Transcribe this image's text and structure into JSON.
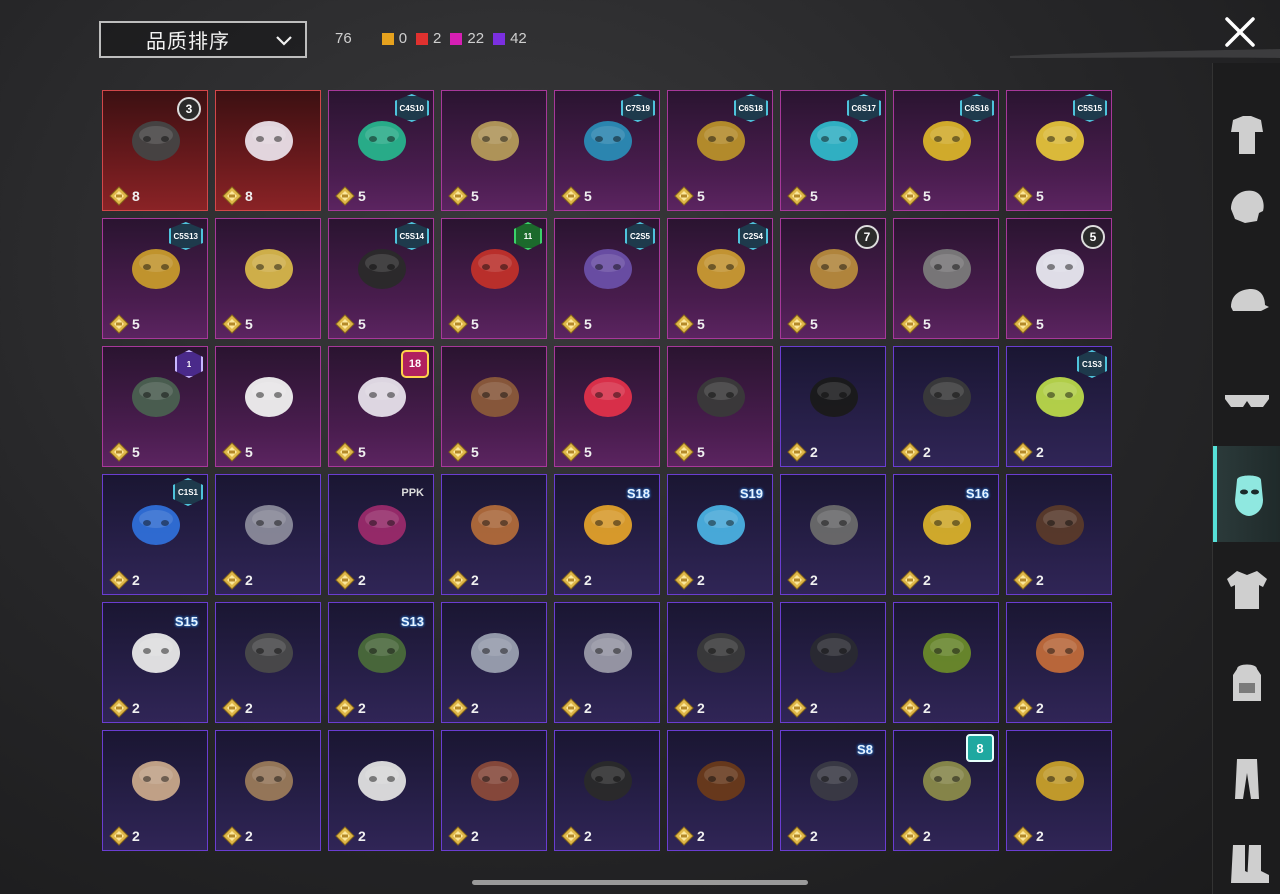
{
  "header": {
    "sort_label": "品质排序",
    "total_count": "76",
    "counts": [
      {
        "color": "#e6a21e",
        "value": "0"
      },
      {
        "color": "#e0312f",
        "value": "2"
      },
      {
        "color": "#d61fb4",
        "value": "22"
      },
      {
        "color": "#7b2fe0",
        "value": "42"
      }
    ]
  },
  "sidebar": {
    "active_index": 4,
    "categories": [
      {
        "icon": "outfit-icon"
      },
      {
        "icon": "face-icon"
      },
      {
        "icon": "cap-icon"
      },
      {
        "icon": "glasses-icon"
      },
      {
        "icon": "mask-icon"
      },
      {
        "icon": "jacket-icon"
      },
      {
        "icon": "backpack-icon"
      },
      {
        "icon": "pants-icon"
      },
      {
        "icon": "boots-icon"
      }
    ]
  },
  "items": [
    {
      "q": "red",
      "price": "8",
      "tag": "3",
      "tag_style": "num",
      "icon": "wolf-mask-icon",
      "col": "#444"
    },
    {
      "q": "red",
      "price": "8",
      "tag": "",
      "tag_style": "",
      "icon": "cloth-mask-icon",
      "col": "#e9dfe8"
    },
    {
      "q": "pink",
      "price": "5",
      "tag": "C4S10",
      "tag_style": "",
      "icon": "green-mask-icon",
      "col": "#27b38c"
    },
    {
      "q": "pink",
      "price": "5",
      "tag": "",
      "tag_style": "",
      "icon": "duck-mask-icon",
      "col": "#b49a5a"
    },
    {
      "q": "pink",
      "price": "5",
      "tag": "C7S19",
      "tag_style": "",
      "icon": "tech-mask-icon",
      "col": "#2a8bb5"
    },
    {
      "q": "pink",
      "price": "5",
      "tag": "C6S18",
      "tag_style": "",
      "icon": "gold-mandible-icon",
      "col": "#b8902a"
    },
    {
      "q": "pink",
      "price": "5",
      "tag": "C6S17",
      "tag_style": "",
      "icon": "graffiti-mask-icon",
      "col": "#2fb7c9"
    },
    {
      "q": "pink",
      "price": "5",
      "tag": "C6S16",
      "tag_style": "",
      "icon": "gas-mask-icon",
      "col": "#d8b22a"
    },
    {
      "q": "pink",
      "price": "5",
      "tag": "C5S15",
      "tag_style": "",
      "icon": "respirator-icon",
      "col": "#e3c23a"
    },
    {
      "q": "pink",
      "price": "5",
      "tag": "C5S13",
      "tag_style": "",
      "icon": "black-gold-mask-icon",
      "col": "#c79a2c"
    },
    {
      "q": "pink",
      "price": "5",
      "tag": "",
      "tag_style": "",
      "icon": "gold-helm-mask-icon",
      "col": "#d6b64a"
    },
    {
      "q": "pink",
      "price": "5",
      "tag": "C5S14",
      "tag_style": "",
      "icon": "black-mask-icon",
      "col": "#2a2a2a"
    },
    {
      "q": "pink",
      "price": "5",
      "tag": "11",
      "tag_style": "green",
      "icon": "oni-mask-icon",
      "col": "#c0302a"
    },
    {
      "q": "pink",
      "price": "5",
      "tag": "C2S5",
      "tag_style": "",
      "icon": "purple-mask-icon",
      "col": "#6a4fa8"
    },
    {
      "q": "pink",
      "price": "5",
      "tag": "C2S4",
      "tag_style": "",
      "icon": "gold-tech-mask-icon",
      "col": "#c99a32"
    },
    {
      "q": "pink",
      "price": "5",
      "tag": "7",
      "tag_style": "num",
      "icon": "gold-purple-mask-icon",
      "col": "#b68a3c"
    },
    {
      "q": "pink",
      "price": "5",
      "tag": "",
      "tag_style": "",
      "icon": "steel-mask-icon",
      "col": "#7a7a7a"
    },
    {
      "q": "pink",
      "price": "5",
      "tag": "5",
      "tag_style": "num",
      "icon": "clown-mask-icon",
      "col": "#e8e8f0"
    },
    {
      "q": "pink",
      "price": "5",
      "tag": "1",
      "tag_style": "violet",
      "icon": "dark-helm-icon",
      "col": "#4a6050"
    },
    {
      "q": "pink",
      "price": "5",
      "tag": "",
      "tag_style": "",
      "icon": "jester-mask-icon",
      "col": "#f0f0f0"
    },
    {
      "q": "pink",
      "price": "5",
      "tag": "18",
      "tag_style": "pink",
      "icon": "x-mask-icon",
      "col": "#e6e0ea"
    },
    {
      "q": "pink",
      "price": "5",
      "tag": "",
      "tag_style": "",
      "icon": "plague-mask-icon",
      "col": "#8a5a3a"
    },
    {
      "q": "pink",
      "price": "5",
      "tag": "",
      "tag_style": "",
      "icon": "red-nose-icon",
      "col": "#e0304a"
    },
    {
      "q": "pink",
      "price": "5",
      "tag": "",
      "tag_style": "",
      "icon": "skull-scarf-icon",
      "col": "#3a3a3a"
    },
    {
      "q": "purple",
      "price": "2",
      "tag": "",
      "tag_style": "",
      "icon": "balaclava-icon",
      "col": "#1a1a1a"
    },
    {
      "q": "purple",
      "price": "2",
      "tag": "",
      "tag_style": "",
      "icon": "red-lens-icon",
      "col": "#3a3a3a"
    },
    {
      "q": "purple",
      "price": "2",
      "tag": "C1S3",
      "tag_style": "",
      "icon": "cactus-mask-icon",
      "col": "#b9d84a"
    },
    {
      "q": "purple",
      "price": "2",
      "tag": "C1S1",
      "tag_style": "",
      "icon": "blue-white-mask-icon",
      "col": "#2f6fd8"
    },
    {
      "q": "purple",
      "price": "2",
      "tag": "",
      "tag_style": "",
      "icon": "steel-half-mask-icon",
      "col": "#8a8a9a"
    },
    {
      "q": "purple",
      "price": "2",
      "tag": "PPK",
      "tag_style": "ppk",
      "icon": "magenta-mask-icon",
      "col": "#9a2a6a"
    },
    {
      "q": "purple",
      "price": "2",
      "tag": "",
      "tag_style": "",
      "icon": "goggle-skull-icon",
      "col": "#b06a3a"
    },
    {
      "q": "purple",
      "price": "2",
      "tag": "S18",
      "tag_style": "season",
      "icon": "neon-mask-icon",
      "col": "#e0a02a"
    },
    {
      "q": "purple",
      "price": "2",
      "tag": "S19",
      "tag_style": "season",
      "icon": "visor-mask-icon",
      "col": "#4ab0e0"
    },
    {
      "q": "purple",
      "price": "2",
      "tag": "",
      "tag_style": "",
      "icon": "grey-mask-icon",
      "col": "#6a6a6a"
    },
    {
      "q": "purple",
      "price": "2",
      "tag": "S16",
      "tag_style": "season",
      "icon": "yellow-visor-icon",
      "col": "#d8b02a"
    },
    {
      "q": "purple",
      "price": "2",
      "tag": "",
      "tag_style": "",
      "icon": "bandana-icon",
      "col": "#5a3a2a"
    },
    {
      "q": "purple",
      "price": "2",
      "tag": "S15",
      "tag_style": "season",
      "icon": "oni-skull-icon",
      "col": "#e8e8e8"
    },
    {
      "q": "purple",
      "price": "2",
      "tag": "",
      "tag_style": "",
      "icon": "eye-mask-icon",
      "col": "#4a4a4a"
    },
    {
      "q": "purple",
      "price": "2",
      "tag": "S13",
      "tag_style": "season",
      "icon": "army-helm-icon",
      "col": "#4a6a3a"
    },
    {
      "q": "purple",
      "price": "2",
      "tag": "",
      "tag_style": "",
      "icon": "chrome-mask-icon",
      "col": "#9aa0b0"
    },
    {
      "q": "purple",
      "price": "2",
      "tag": "",
      "tag_style": "",
      "icon": "cage-mask-icon",
      "col": "#9a9aa8"
    },
    {
      "q": "purple",
      "price": "2",
      "tag": "",
      "tag_style": "",
      "icon": "black-strap-icon",
      "col": "#3a3a3a"
    },
    {
      "q": "purple",
      "price": "2",
      "tag": "",
      "tag_style": "",
      "icon": "dark-scarf-icon",
      "col": "#2a2a32"
    },
    {
      "q": "purple",
      "price": "2",
      "tag": "",
      "tag_style": "",
      "icon": "green-shemagh-icon",
      "col": "#6a8a2a"
    },
    {
      "q": "purple",
      "price": "2",
      "tag": "",
      "tag_style": "",
      "icon": "orange-shemagh-icon",
      "col": "#c06a3a"
    },
    {
      "q": "purple",
      "price": "2",
      "tag": "",
      "tag_style": "",
      "icon": "mummy-mask-icon",
      "col": "#c8a88a"
    },
    {
      "q": "purple",
      "price": "2",
      "tag": "",
      "tag_style": "",
      "icon": "old-gasmask-icon",
      "col": "#9a7a5a"
    },
    {
      "q": "purple",
      "price": "2",
      "tag": "",
      "tag_style": "",
      "icon": "evil-clown-icon",
      "col": "#e0e0e0"
    },
    {
      "q": "purple",
      "price": "2",
      "tag": "",
      "tag_style": "",
      "icon": "teeth-mask-icon",
      "col": "#8a4a3a"
    },
    {
      "q": "purple",
      "price": "2",
      "tag": "",
      "tag_style": "",
      "icon": "m-logo-mask-icon",
      "col": "#2a2a2a"
    },
    {
      "q": "purple",
      "price": "2",
      "tag": "",
      "tag_style": "",
      "icon": "mustache-icon",
      "col": "#6a3a1a"
    },
    {
      "q": "purple",
      "price": "2",
      "tag": "S8",
      "tag_style": "season",
      "icon": "flame-scarf-icon",
      "col": "#3a3a44"
    },
    {
      "q": "purple",
      "price": "2",
      "tag": "8",
      "tag_style": "teal",
      "icon": "camo-mask-icon",
      "col": "#8a8a4a"
    },
    {
      "q": "purple",
      "price": "2",
      "tag": "",
      "tag_style": "",
      "icon": "studded-mask-icon",
      "col": "#c8a02a"
    }
  ]
}
